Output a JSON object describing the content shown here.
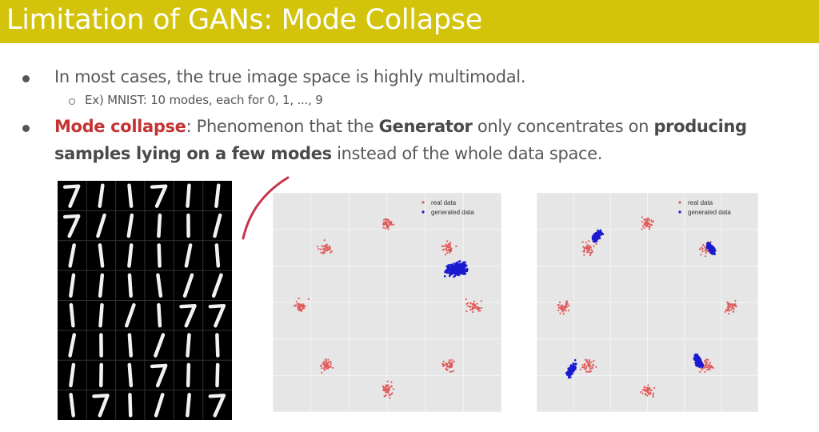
{
  "slide": {
    "title": "Limitation of GANs: Mode Collapse"
  },
  "bullets": {
    "b1": "In most cases, the true image space is highly multimodal.",
    "sub1": "Ex) MNIST: 10 modes, each for 0, 1, ..., 9",
    "b2_part1": "Mode collapse",
    "b2_part2": ": Phenomenon that the ",
    "b2_part3": "Generator",
    "b2_part4": " only concentrates on ",
    "b2_part5": "producing",
    "b2_part6": "samples lying on a few modes",
    "b2_part7": " instead of the whole data space."
  },
  "mnist_grid": {
    "rows": [
      [
        "7",
        "1",
        "1",
        "7",
        "1",
        "1"
      ],
      [
        "7",
        "1",
        "1",
        "1",
        "1",
        "1"
      ],
      [
        "1",
        "1",
        "1",
        "1",
        "1",
        "1"
      ],
      [
        "1",
        "1",
        "1",
        "1",
        "1",
        "1"
      ],
      [
        "1",
        "1",
        "1",
        "1",
        "7",
        "7"
      ],
      [
        "1",
        "1",
        "1",
        "1",
        "1",
        "1"
      ],
      [
        "1",
        "1",
        "1",
        "7",
        "1",
        "1"
      ],
      [
        "1",
        "7",
        "1",
        "1",
        "1",
        "7"
      ]
    ]
  },
  "colors": {
    "title_bar": "#d3c30a",
    "real": "#e05a5a",
    "generated": "#1a1ad0",
    "panel_bg": "#e6e6e6",
    "annotation": "#c8354a"
  },
  "chart_data": [
    {
      "type": "scatter",
      "legend": [
        "real data",
        "generated data"
      ],
      "legend_position": "top-right",
      "series": [
        {
          "name": "real data",
          "clusters": [
            [
              -0.7,
              0.7
            ],
            [
              0,
              1
            ],
            [
              0.7,
              0.7
            ],
            [
              1,
              0
            ],
            [
              0.7,
              -0.7
            ],
            [
              0,
              -1
            ],
            [
              -0.7,
              -0.7
            ],
            [
              -1,
              0
            ]
          ]
        },
        {
          "name": "generated data",
          "clusters": [
            [
              0.8,
              0.45
            ]
          ]
        }
      ]
    },
    {
      "type": "scatter",
      "legend": [
        "real data",
        "generated data"
      ],
      "legend_position": "top-right",
      "series": [
        {
          "name": "real data",
          "clusters": [
            [
              -0.7,
              0.7
            ],
            [
              0,
              1
            ],
            [
              0.7,
              0.7
            ],
            [
              1,
              0
            ],
            [
              0.7,
              -0.7
            ],
            [
              0,
              -1
            ],
            [
              -0.7,
              -0.7
            ],
            [
              -1,
              0
            ]
          ]
        },
        {
          "name": "generated data",
          "clusters": [
            [
              -0.6,
              0.85
            ],
            [
              0.75,
              0.7
            ],
            [
              -0.9,
              -0.75
            ],
            [
              0.6,
              -0.65
            ]
          ]
        }
      ]
    }
  ]
}
